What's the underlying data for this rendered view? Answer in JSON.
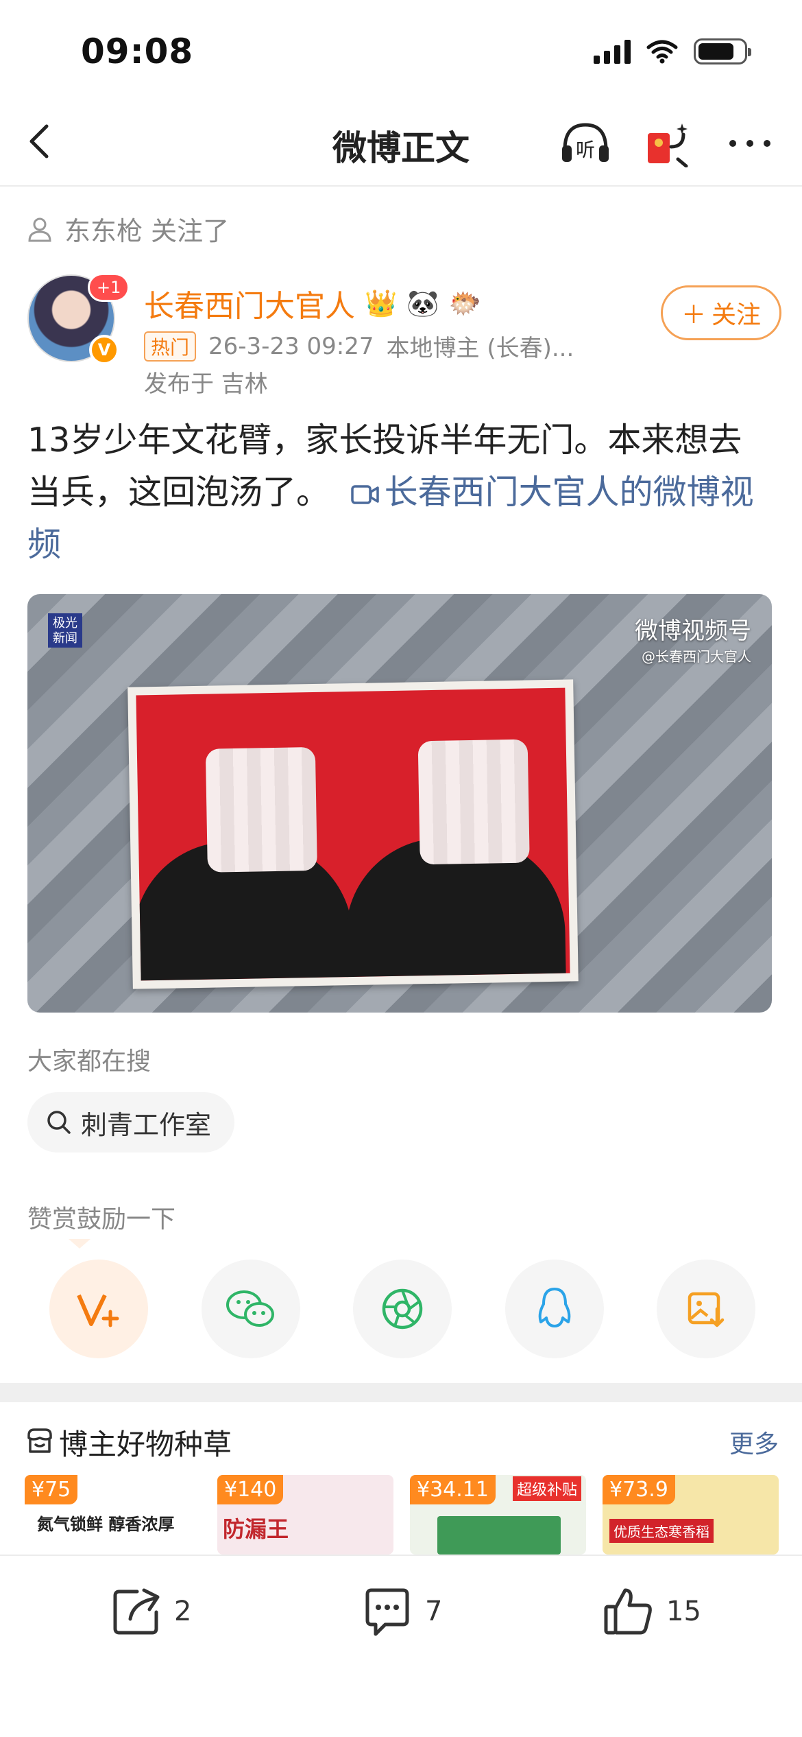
{
  "status_bar": {
    "time": "09:08"
  },
  "nav": {
    "title": "微博正文",
    "listen_label": "听"
  },
  "follow_notice": {
    "text": "东东枪 关注了"
  },
  "author": {
    "name": "长春西门大官人",
    "avatar_badge": "+1",
    "hot_tag": "热门",
    "timestamp": "26-3-23 09:27",
    "source": "本地博主 (长春)...",
    "location": "发布于 吉林",
    "follow_label": "关注"
  },
  "post": {
    "text": "13岁少年文花臂，家长投诉半年无门。本来想去当兵，这回泡汤了。",
    "link_text": "长春西门大官人的微博视频"
  },
  "video": {
    "source_logo": "极光新闻",
    "watermark": "微博视频号",
    "watermark_handle": "@长春西门大官人"
  },
  "search_section": {
    "label": "大家都在搜",
    "chip": "刺青工作室"
  },
  "reward_section": {
    "label": "赞赏鼓励一下"
  },
  "share_buttons": [
    "reward-v-plus",
    "wechat",
    "moments",
    "qq",
    "save-image"
  ],
  "products": {
    "title": "博主好物种草",
    "more": "更多",
    "items": [
      {
        "price": "¥75",
        "caption": "氮气锁鲜 醇香浓厚"
      },
      {
        "price": "¥140",
        "caption": "防漏王"
      },
      {
        "price": "¥34.11",
        "caption": "超级补贴"
      },
      {
        "price": "¥73.9",
        "caption": "优质生态寒香稻"
      }
    ]
  },
  "bottom_bar": {
    "reposts": "2",
    "comments": "7",
    "likes": "15"
  },
  "colors": {
    "accent": "#f47b10",
    "link": "#4b6a9b",
    "price": "#ff8a1f"
  }
}
